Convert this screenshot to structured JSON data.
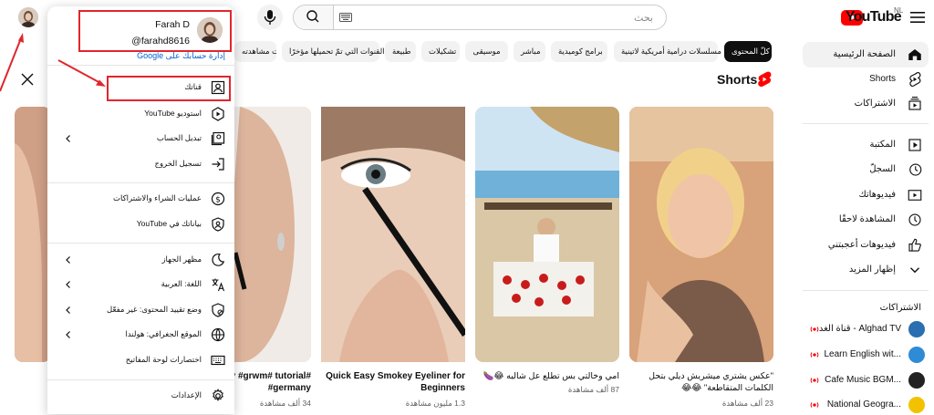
{
  "topbar": {
    "search_placeholder": "بحث"
  },
  "logo": {
    "text": "YouTube",
    "region": "NL"
  },
  "chips": [
    {
      "label": "كلّ المحتوى",
      "active": true
    },
    {
      "label": "مسلسلات درامية أمريكية لاتينية"
    },
    {
      "label": "برامج كوميدية"
    },
    {
      "label": "مباشر"
    },
    {
      "label": "موسيقى"
    },
    {
      "label": "تشكيلات"
    },
    {
      "label": "طبيعة"
    },
    {
      "label": "القنوات التي تمّ تحميلها مؤخرًا"
    },
    {
      "label": "تمّت مشاهدته"
    }
  ],
  "sidebar": {
    "items": [
      {
        "label": "الصفحة الرئيسية",
        "icon": "home-icon",
        "active": true
      },
      {
        "label": "Shorts",
        "icon": "shorts-icon"
      },
      {
        "label": "الاشتراكات",
        "icon": "subscriptions-icon"
      },
      {
        "label": "المكتبة",
        "icon": "library-icon"
      },
      {
        "label": "السجلّ",
        "icon": "history-icon"
      },
      {
        "label": "فيديوهاتك",
        "icon": "your-videos-icon"
      },
      {
        "label": "المشاهدة لاحقًا",
        "icon": "watch-later-icon"
      },
      {
        "label": "فيديوهات أعجبتني",
        "icon": "liked-icon"
      },
      {
        "label": "إظهار المزيد",
        "icon": "chevron-down-icon"
      }
    ],
    "subscriptions_heading": "الاشتراكات",
    "subscriptions": [
      {
        "name": "قناة الغد - Alghad TV",
        "color": "#2a6fb0"
      },
      {
        "name": "Learn English wit...",
        "color": "#2e8bd6"
      },
      {
        "name": "Cafe Music BGM...",
        "color": "#222222"
      },
      {
        "name": "National Geogra...",
        "color": "#f2c200"
      }
    ]
  },
  "shorts": {
    "title": "Shorts",
    "cards": [
      {
        "title": "\"عكس يشتري ميشريش ديلي بتحل الكلمات المتقاطعة\" 😂😂",
        "views": "23 ألف مشاهدة"
      },
      {
        "title": "امي وخالتي بس تطلع عل شاليه 😂🍆",
        "views": "87 ألف مشاهدة"
      },
      {
        "title": "Quick Easy Smokey Eyeliner for Beginners",
        "views": "1.3 مليون مشاهدة"
      },
      {
        "title": "#beauty #grwm# tutorial #germany",
        "views": "34 ألف مشاهدة"
      }
    ]
  },
  "account": {
    "name": "Farah D",
    "handle": "@farahd8616",
    "manage_link": "إدارة حسابك على Google",
    "items": [
      {
        "label": "قناتك",
        "icon": "channel-icon"
      },
      {
        "label": "استوديو YouTube",
        "icon": "studio-icon"
      },
      {
        "label": "تبديل الحساب",
        "icon": "switch-account-icon",
        "chevron": true
      },
      {
        "label": "تسجيل الخروج",
        "icon": "sign-out-icon"
      },
      {
        "label": "عمليات الشراء والاشتراكات",
        "icon": "purchases-icon"
      },
      {
        "label": "بياناتك في YouTube",
        "icon": "your-data-icon"
      },
      {
        "label": "مظهر الجهاز",
        "icon": "appearance-icon",
        "chevron": true
      },
      {
        "label": "اللغة: العربية",
        "icon": "language-icon",
        "chevron": true
      },
      {
        "label": "وضع تقييد المحتوى: غير مفعّل",
        "icon": "restricted-icon",
        "chevron": true
      },
      {
        "label": "الموقع الجغرافي: هولندا",
        "icon": "location-icon",
        "chevron": true
      },
      {
        "label": "اختصارات لوحة المفاتيح",
        "icon": "keyboard-icon"
      },
      {
        "label": "الإعدادات",
        "icon": "settings-icon"
      }
    ]
  },
  "colors": {
    "accent_red": "#ff0000",
    "annotation": "#e0262c",
    "link": "#065fd4"
  }
}
